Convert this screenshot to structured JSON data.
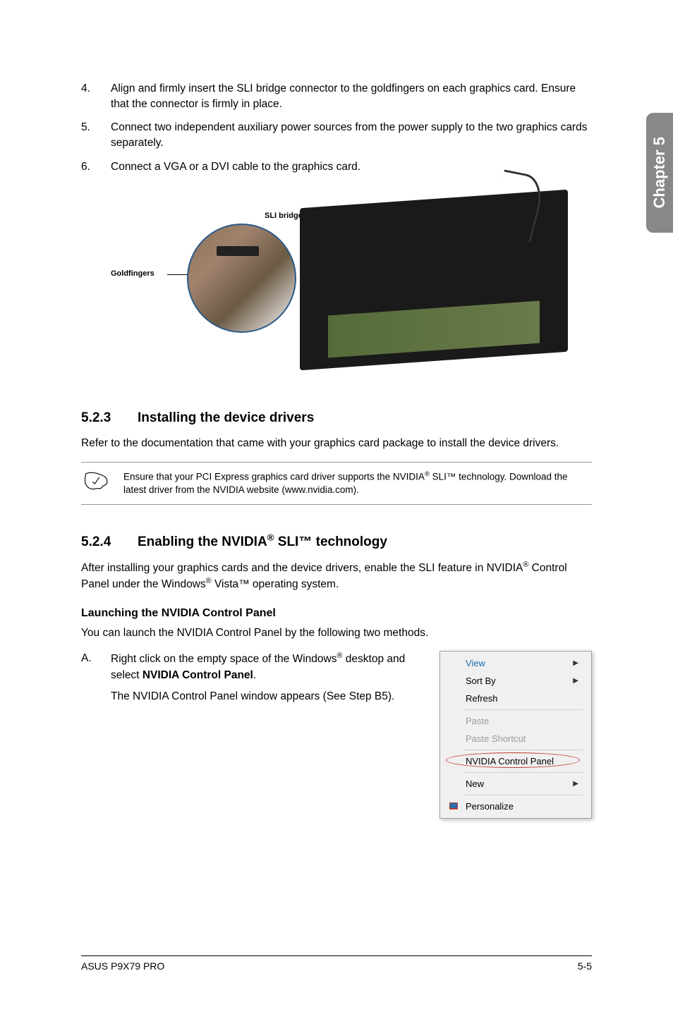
{
  "sidebar": {
    "label": "Chapter 5"
  },
  "steps": [
    {
      "num": "4.",
      "text": "Align and firmly insert the SLI bridge connector to the goldfingers on each graphics card. Ensure that the connector is firmly in place."
    },
    {
      "num": "5.",
      "text": "Connect two independent auxiliary power sources from the power supply to the two graphics cards separately."
    },
    {
      "num": "6.",
      "text": "Connect a VGA or a DVI cable to the graphics card."
    }
  ],
  "figure": {
    "sli_label": "SLI bridge",
    "gold_label": "Goldfingers"
  },
  "sec523": {
    "num": "5.2.3",
    "title": "Installing the device drivers",
    "body": "Refer to the documentation that came with your graphics card package to install the device drivers.",
    "note_pre": "Ensure that your PCI Express graphics card driver supports the NVIDIA",
    "note_mid": " SLI™ technology. Download the latest driver from the NVIDIA website (www.nvidia.com)."
  },
  "sec524": {
    "num": "5.2.4",
    "title_pre": "Enabling the NVIDIA",
    "title_post": " SLI™ technology",
    "body_pre": "After installing your graphics cards and the device drivers, enable the SLI feature in NVIDIA",
    "body_mid": " Control Panel under the Windows",
    "body_post": " Vista™ operating system.",
    "launch_heading": "Launching the NVIDIA Control Panel",
    "launch_body": "You can launch the NVIDIA Control Panel by the following two methods.",
    "stepA": {
      "letter": "A.",
      "line1_pre": "Right click on the empty space of the Windows",
      "line1_post": " desktop and select ",
      "line1_bold": "NVIDIA Control Panel",
      "line1_end": ".",
      "line2": "The NVIDIA Control Panel window appears (See Step B5)."
    }
  },
  "menu": {
    "view": "View",
    "sortby": "Sort By",
    "refresh": "Refresh",
    "paste": "Paste",
    "paste_shortcut": "Paste Shortcut",
    "nvidia": "NVIDIA Control Panel",
    "new": "New",
    "personalize": "Personalize"
  },
  "footer": {
    "left": "ASUS P9X79 PRO",
    "right": "5-5"
  }
}
